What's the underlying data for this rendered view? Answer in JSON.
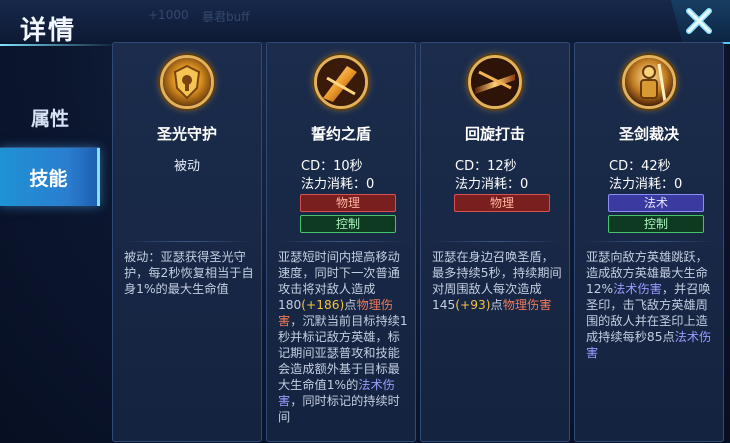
{
  "header": {
    "title": "详情",
    "ghost_texts": [
      "+1000",
      "暴君buff"
    ]
  },
  "sidebar": {
    "tabs": [
      {
        "label": "属性",
        "active": false
      },
      {
        "label": "技能",
        "active": true
      }
    ]
  },
  "colors": {
    "accent": "#2a8fd6",
    "gold_frame": "#e3b25a",
    "physical": "#d95050",
    "control": "#48c36b",
    "magic": "#8c8cf5",
    "highlight": "#f4c33e"
  },
  "skills": [
    {
      "name": "圣光守护",
      "icon": "shield-emblem-icon",
      "passive_label": "被动",
      "description": [
        {
          "t": "被动：亚瑟获得圣光守护，每2秒恢复相当于自身1%的最大生命值",
          "c": ""
        }
      ]
    },
    {
      "name": "誓约之盾",
      "icon": "shield-strike-icon",
      "cd": "CD：10秒",
      "mana": "法力消耗：0",
      "tags": [
        {
          "label": "物理",
          "type": "phys"
        },
        {
          "label": "控制",
          "type": "ctrl"
        }
      ],
      "description": [
        {
          "t": "亚瑟短时间内提高移动速度，同时下一次普通攻击将对敌人造成180",
          "c": ""
        },
        {
          "t": "(+186)",
          "c": "hi"
        },
        {
          "t": "点",
          "c": ""
        },
        {
          "t": "物理伤害",
          "c": "ph"
        },
        {
          "t": "，沉默当前目标持续1秒并标记敌方英雄，标记期间亚瑟普攻和技能会造成额外基于目标最大生命值1%的",
          "c": ""
        },
        {
          "t": "法术伤害",
          "c": "mg"
        },
        {
          "t": "，同时标记的持续时间",
          "c": ""
        }
      ]
    },
    {
      "name": "回旋打击",
      "icon": "spinning-swords-icon",
      "cd": "CD：12秒",
      "mana": "法力消耗：0",
      "tags": [
        {
          "label": "物理",
          "type": "phys"
        }
      ],
      "description": [
        {
          "t": "亚瑟在身边召唤圣盾，最多持续5秒，持续期间对周围敌人每次造成145",
          "c": ""
        },
        {
          "t": "(+93)",
          "c": "hi"
        },
        {
          "t": "点",
          "c": ""
        },
        {
          "t": "物理伤害",
          "c": "ph"
        }
      ]
    },
    {
      "name": "圣剑裁决",
      "icon": "holy-sword-icon",
      "cd": "CD：42秒",
      "mana": "法力消耗：0",
      "tags": [
        {
          "label": "法术",
          "type": "mag"
        },
        {
          "label": "控制",
          "type": "ctrl"
        }
      ],
      "description": [
        {
          "t": "亚瑟向敌方英雄跳跃，造成敌方英雄最大生命12%",
          "c": ""
        },
        {
          "t": "法术伤害",
          "c": "mg"
        },
        {
          "t": "，并召唤圣印，击飞敌方英雄周围的敌人并在圣印上造成持续每秒85点",
          "c": ""
        },
        {
          "t": "法术伤害",
          "c": "mg"
        }
      ]
    }
  ]
}
